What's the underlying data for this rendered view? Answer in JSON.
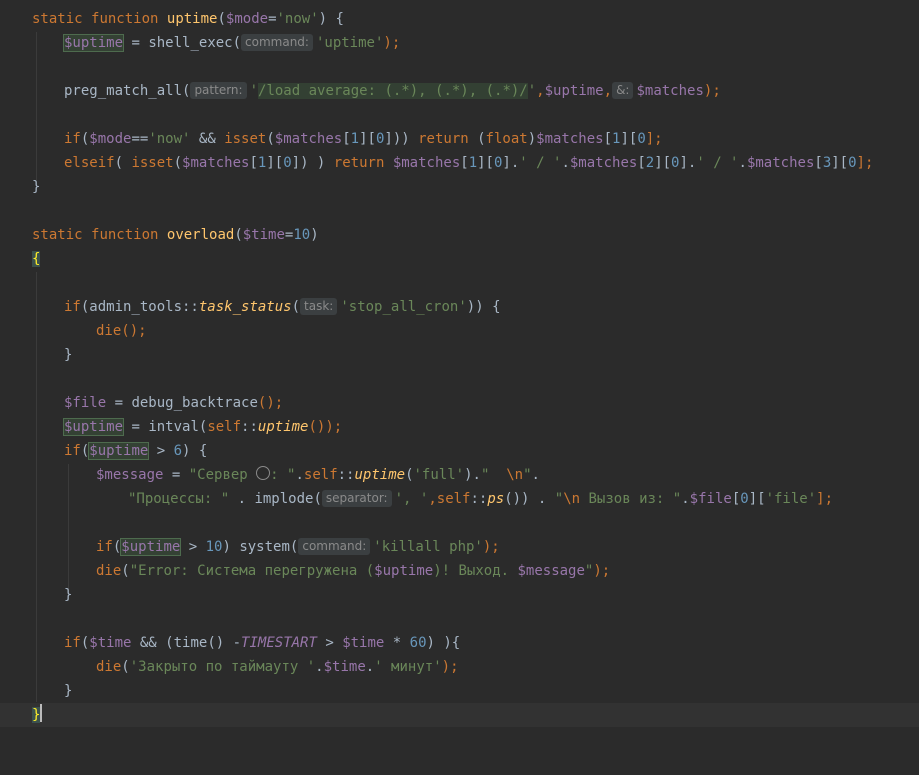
{
  "editor": {
    "l1": {
      "static": "static",
      "function": "function",
      "name": "uptime",
      "p1": "(",
      "param": "$mode",
      "eq": "=",
      "def": "'now'",
      "p2": ") {"
    },
    "l2": {
      "var": "$uptime",
      "eq": " = ",
      "call": "shell_exec(",
      "hint": "command:",
      "str": "'uptime'",
      "end": ");"
    },
    "l4": {
      "call": "preg_match_all(",
      "hint1": "pattern:",
      "q1": "'",
      "regex": "/load average: (.*), (.*), (.*)/",
      "q2": "'",
      "comma1": ",",
      "var1": "$uptime",
      "comma2": ",",
      "hint2": "&:",
      "var2": "$matches",
      "end": ");"
    },
    "l6": {
      "if": "if",
      "p1": "(",
      "v1": "$mode",
      "op": "==",
      "s1": "'now'",
      "and": " && ",
      "isset": "isset",
      "p2": "(",
      "v2": "$matches",
      "i1": "[",
      "n1": "1",
      "i2": "][",
      "n2": "0",
      "i3": "])) ",
      "ret": "return",
      "cast1": " (",
      "float": "float",
      "cast2": ")",
      "v3": "$matches",
      "i4": "[",
      "n3": "1",
      "i5": "][",
      "n4": "0",
      "i6": "];"
    },
    "l7": {
      "elseif": "elseif",
      "p1": "( ",
      "isset": "isset",
      "p2": "(",
      "v1": "$matches",
      "i1": "[",
      "n1": "1",
      "i2": "][",
      "n2": "0",
      "i3": "]) ) ",
      "ret": "return",
      "sp": " ",
      "v2": "$matches",
      "i4": "[",
      "n3": "1",
      "i5": "][",
      "n4": "0",
      "i6": "].",
      "s1": "' / '",
      "d1": ".",
      "v3": "$matches",
      "i7": "[",
      "n5": "2",
      "i8": "][",
      "n6": "0",
      "i9": "].",
      "s2": "' / '",
      "d2": ".",
      "v4": "$matches",
      "i10": "[",
      "n7": "3",
      "i11": "][",
      "n8": "0",
      "i12": "];"
    },
    "l8": {
      "brace": "}"
    },
    "l10": {
      "static": "static",
      "function": "function",
      "name": "overload",
      "p1": "(",
      "param": "$time",
      "eq": "=",
      "def": "10",
      "p2": ")"
    },
    "l11": {
      "brace": "{"
    },
    "l13": {
      "if": "if",
      "p1": "(admin_tools::",
      "method": "task_status",
      "p2": "(",
      "hint": "task:",
      "str": "'stop_all_cron'",
      "end": ")) {"
    },
    "l14": {
      "die": "die",
      "end": "();"
    },
    "l15": {
      "brace": "}"
    },
    "l17": {
      "var": "$file",
      "eq": " = ",
      "call": "debug_backtrace",
      "end": "();"
    },
    "l18": {
      "var": "$uptime",
      "eq": " = ",
      "call": "intval(",
      "self": "self",
      "dc": "::",
      "method": "uptime",
      "end": "());"
    },
    "l19": {
      "if": "if",
      "p1": "(",
      "var": "$uptime",
      "gt": " > ",
      "num": "6",
      "end": ") {"
    },
    "l20": {
      "var": "$message",
      "eq": " = ",
      "s1": "\"Сервер ",
      "s1b": ": \"",
      "dot1": ".",
      "self": "self",
      "dc": "::",
      "method": "uptime",
      "p1": "(",
      "s2": "'full'",
      "p2": ")",
      "dot2": ".",
      "s3": "\"  ",
      "esc": "\\n",
      "s3b": "\"",
      "dot3": "."
    },
    "l21": {
      "s1": "\"Процессы: \"",
      "dot1": " . ",
      "call": "implode(",
      "hint": "separator:",
      "s2": "', '",
      "comma": ",",
      "self": "self",
      "dc": "::",
      "method": "ps",
      "p": "()) . ",
      "s3": "\"",
      "esc": "\\n",
      "s3b": " Вызов из: \"",
      "dot2": ".",
      "var": "$file",
      "i1": "[",
      "n1": "0",
      "i2": "][",
      "s4": "'file'",
      "end": "];"
    },
    "l23": {
      "if": "if",
      "p1": "(",
      "var": "$uptime",
      "gt": " > ",
      "num": "10",
      "p2": ") ",
      "call": "system(",
      "hint": "command:",
      "str": "'killall php'",
      "end": ");"
    },
    "l24": {
      "die": "die",
      "p1": "(",
      "s1": "\"Error: Система перегружена (",
      "v1": "$uptime",
      "s2": ")! Выход. ",
      "v2": "$message",
      "s3": "\"",
      "end": ");"
    },
    "l25": {
      "brace": "}"
    },
    "l27": {
      "if": "if",
      "p1": "(",
      "v1": "$time",
      "and": " && (",
      "time": "time",
      "p2": "() -",
      "const": "TIMESTART",
      "gt": " > ",
      "v2": "$time",
      "mul": " * ",
      "num": "60",
      "end": ") ){"
    },
    "l28": {
      "die": "die",
      "p1": "(",
      "s1": "'Закрыто по таймауту '",
      "dot1": ".",
      "var": "$time",
      "dot2": ".",
      "s2": "' минут'",
      "end": ");"
    },
    "l29": {
      "brace": "}"
    },
    "l30": {
      "brace": "}"
    }
  },
  "colors": {
    "background": "#2b2b2b",
    "keyword": "#cc7832",
    "function": "#ffc66d",
    "variable": "#9876aa",
    "string": "#6a8759",
    "number": "#6897bb",
    "text": "#a9b7c6"
  }
}
